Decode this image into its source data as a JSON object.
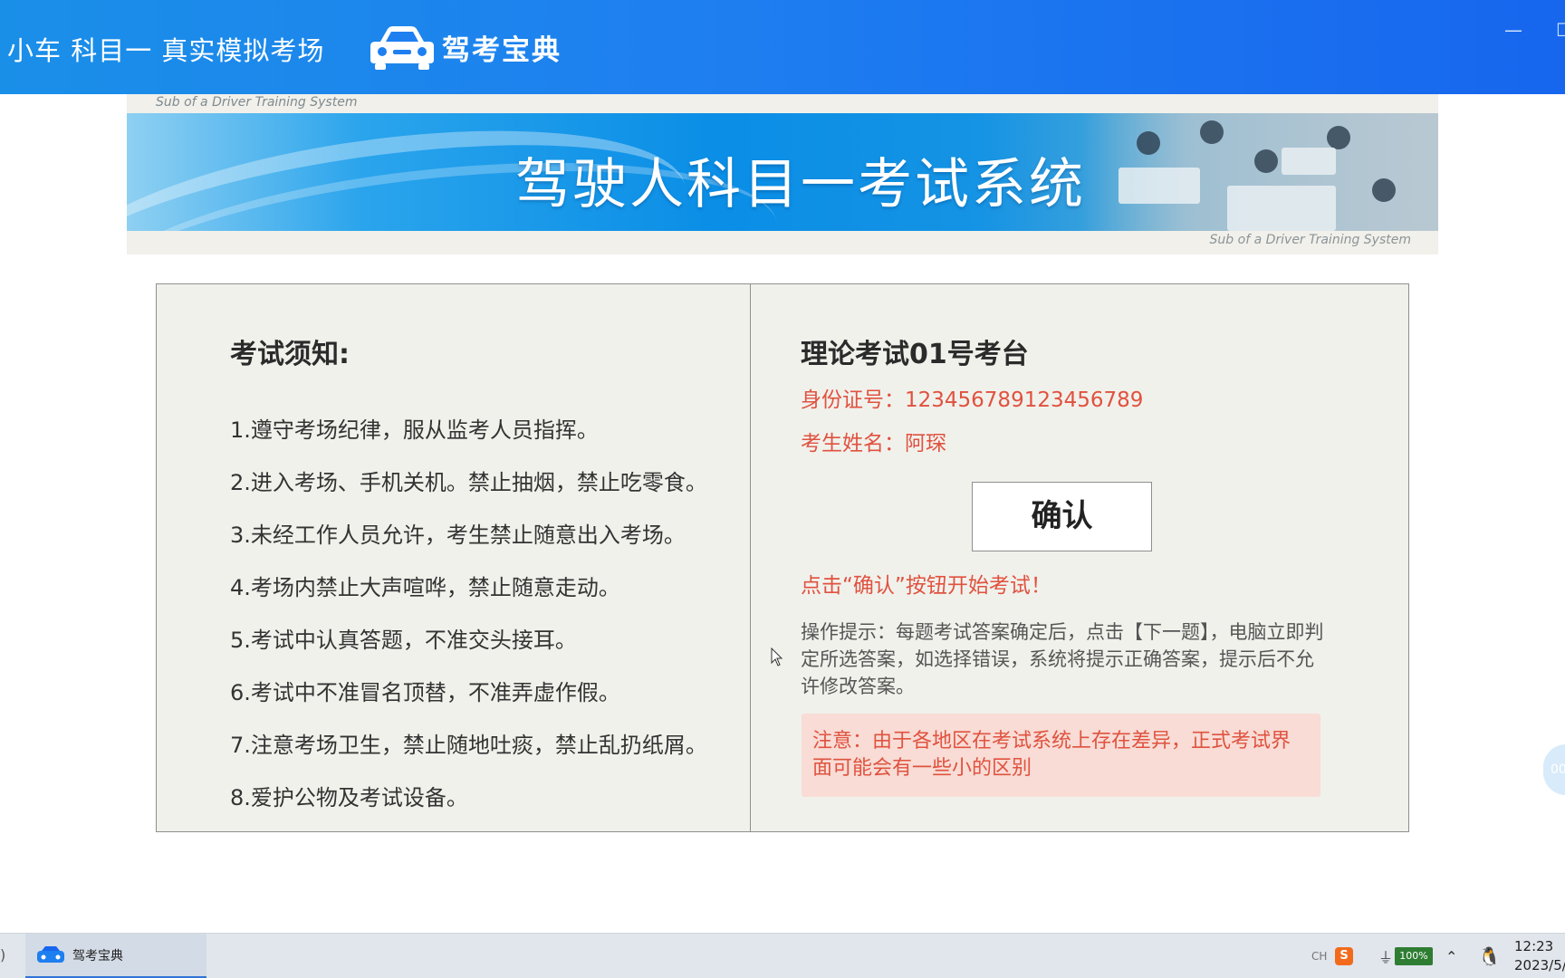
{
  "titlebar": {
    "subject": "小车  科目一  真实模拟考场",
    "logo_text": "驾考宝典"
  },
  "banner": {
    "sub_top": "Sub of a Driver Training System",
    "title": "驾驶人科目一考试系统",
    "sub_bottom": "Sub of a Driver Training System"
  },
  "notice": {
    "heading": "考试须知:",
    "rules": [
      "1.遵守考场纪律，服从监考人员指挥。",
      "2.进入考场、手机关机。禁止抽烟，禁止吃零食。",
      "3.未经工作人员允许，考生禁止随意出入考场。",
      "4.考场内禁止大声喧哗，禁止随意走动。",
      "5.考试中认真答题，不准交头接耳。",
      "6.考试中不准冒名顶替，不准弄虚作假。",
      "7.注意考场卫生，禁止随地吐痰，禁止乱扔纸屑。",
      "8.爱护公物及考试设备。"
    ]
  },
  "exam": {
    "station": "理论考试01号考台",
    "id_line": "身份证号：123456789123456789",
    "name_line": "考生姓名：阿琛",
    "confirm_label": "确认",
    "start_hint": "点击“确认”按钮开始考试！",
    "op_tip": "操作提示：每题考试答案确定后，点击【下一题】，电脑立即判定所选答案，如选择错误，系统将提示正确答案，提示后不允许修改答案。",
    "warning": "注意：由于各地区在考试系统上存在差异，正式考试界面可能会有一些小的区别"
  },
  "float_ball": "00",
  "taskbar": {
    "app_label": "驾考宝典",
    "ime": "CH",
    "sogou": "S",
    "battery": "100%",
    "time": "12:23",
    "date": "2023/5/"
  },
  "colors": {
    "titlebar": "#1e7ff0",
    "accent_red": "#e0523f",
    "panel_bg": "#f1f1ec",
    "warning_bg": "#f8dcd5"
  }
}
